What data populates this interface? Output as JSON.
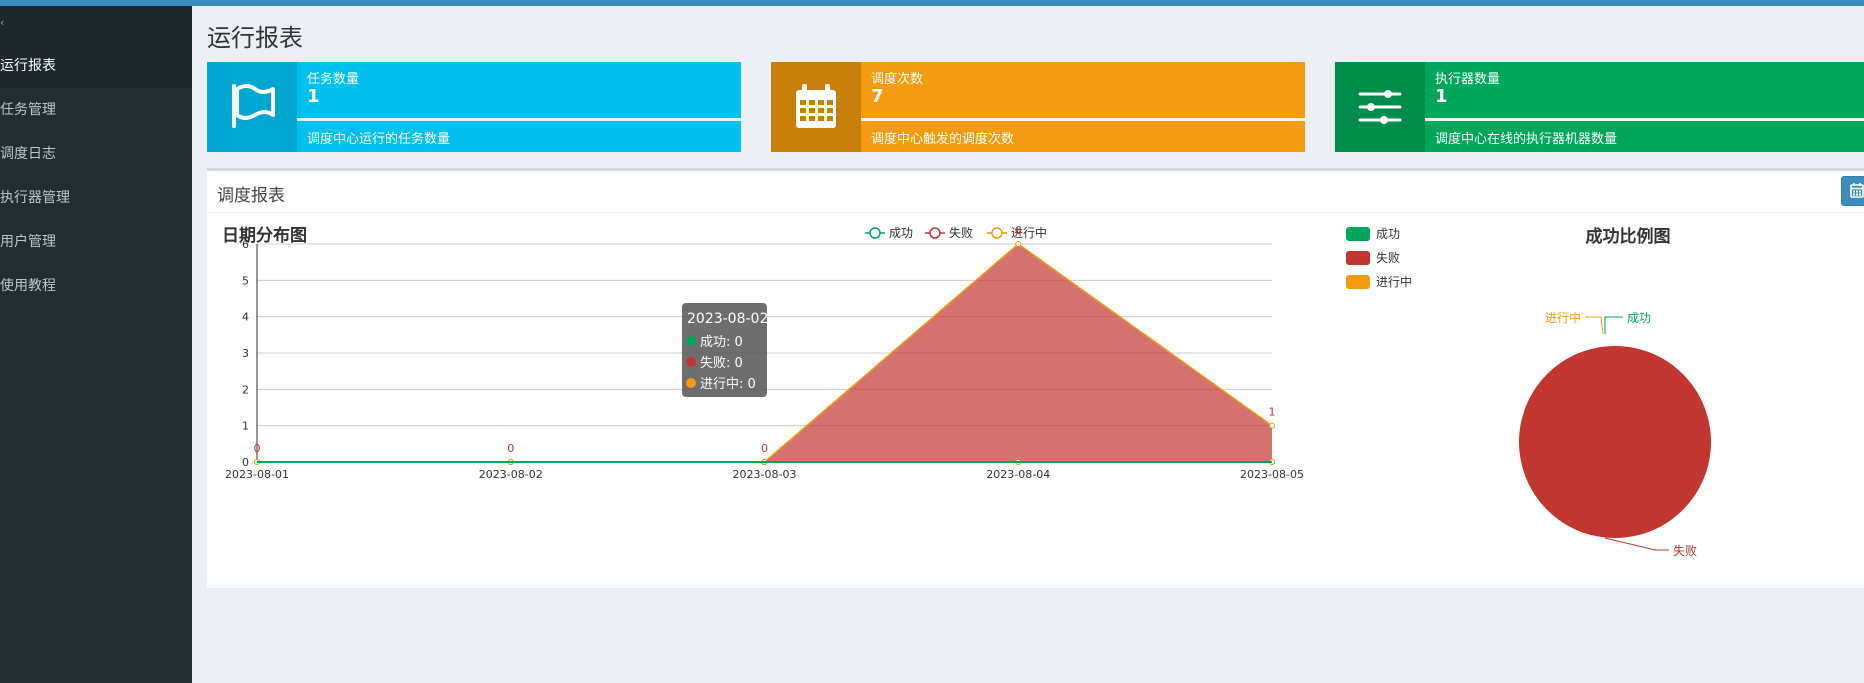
{
  "sidebar": {
    "items": [
      {
        "label": "运行报表",
        "active": true
      },
      {
        "label": "任务管理",
        "active": false
      },
      {
        "label": "调度日志",
        "active": false
      },
      {
        "label": "执行器管理",
        "active": false
      },
      {
        "label": "用户管理",
        "active": false
      },
      {
        "label": "使用教程",
        "active": false
      }
    ]
  },
  "page": {
    "title": "运行报表"
  },
  "info_boxes": [
    {
      "label": "任务数量",
      "value": "1",
      "desc": "调度中心运行的任务数量",
      "icon": "flag-icon",
      "color": "#00c0ef",
      "icon_color": "#00a7d0"
    },
    {
      "label": "调度次数",
      "value": "7",
      "desc": "调度中心触发的调度次数",
      "icon": "calendar-icon",
      "color": "#f39c12",
      "icon_color": "#c87f0a"
    },
    {
      "label": "执行器数量",
      "value": "1",
      "desc": "调度中心在线的执行器机器数量",
      "icon": "sliders-icon",
      "color": "#00a65a",
      "icon_color": "#008d4c"
    }
  ],
  "report_box": {
    "title": "调度报表"
  },
  "chart_data": [
    {
      "type": "line",
      "title": "日期分布图",
      "legend": [
        "成功",
        "失败",
        "进行中"
      ],
      "legend_position": "top-center",
      "x": [
        "2023-08-01",
        "2023-08-02",
        "2023-08-03",
        "2023-08-04",
        "2023-08-05"
      ],
      "ylim": [
        0,
        6
      ],
      "yticks": [
        0,
        1,
        2,
        3,
        4,
        5,
        6
      ],
      "grid": true,
      "series": [
        {
          "name": "成功",
          "values": [
            0,
            0,
            0,
            0,
            0
          ],
          "color": "#00a65a"
        },
        {
          "name": "失败",
          "values": [
            0,
            0,
            0,
            6,
            1
          ],
          "color": "#c23632"
        },
        {
          "name": "进行中",
          "values": [
            0,
            0,
            0,
            0,
            0
          ],
          "color": "#f39c12"
        }
      ],
      "point_labels": [
        "0",
        "0",
        "0",
        "6",
        "1"
      ],
      "tooltip": {
        "title": "2023-08-02",
        "lines": [
          "成功: 0",
          "失败: 0",
          "进行中: 0"
        ]
      }
    },
    {
      "type": "pie",
      "title": "成功比例图",
      "legend": [
        "成功",
        "失败",
        "进行中"
      ],
      "legend_position": "top-left",
      "slices": [
        {
          "name": "成功",
          "value": 0,
          "color": "#00a65a"
        },
        {
          "name": "失败",
          "value": 7,
          "color": "#c23632"
        },
        {
          "name": "进行中",
          "value": 0,
          "color": "#f39c12"
        }
      ]
    }
  ]
}
